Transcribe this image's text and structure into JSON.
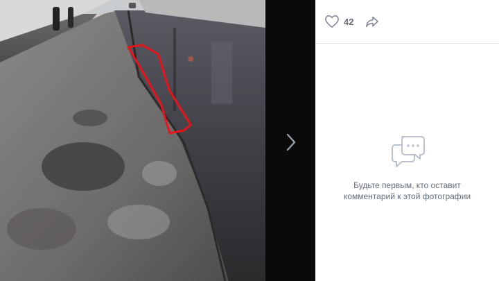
{
  "viewer": {
    "photo": {
      "subject": "snowy-road-with-puddle-photo"
    },
    "next_icon": "chevron-right-icon"
  },
  "sidebar": {
    "likes": {
      "icon": "heart-icon",
      "count": "42"
    },
    "share": {
      "icon": "share-arrow-icon"
    },
    "comments": {
      "icon": "chat-bubbles-icon",
      "empty_line1": "Будьте первым, кто оставит",
      "empty_line2": "комментарий к этой фотографии"
    }
  },
  "colors": {
    "highlight": "#e8141b",
    "muted_text": "#626d7a",
    "icon_gray": "#828a99"
  }
}
